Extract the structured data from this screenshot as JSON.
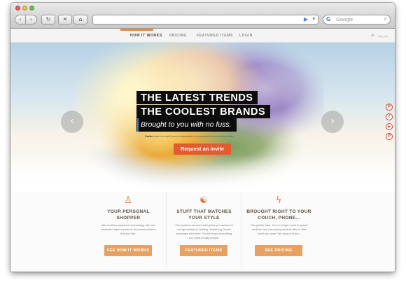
{
  "browser": {
    "back_icon": "‹",
    "forward_icon": "›",
    "reload_icon": "↻",
    "stop_icon": "✕",
    "home_icon": "⌂",
    "go_icon": "▶",
    "url_dropdown_icon": "▾",
    "search_engine_logo": "G",
    "search_placeholder": "Google",
    "search_icon": "⌕"
  },
  "nav": {
    "items": [
      {
        "label": "HOW IT WORKS"
      },
      {
        "label": "PRICING"
      },
      {
        "label": "FEATURED ITEMS"
      },
      {
        "label": "LOGIN"
      }
    ],
    "signin_icon": "⊕",
    "signin_label": "Sign Up",
    "accent": "#e08c4f"
  },
  "hero": {
    "headline_1": "THE LATEST TRENDS",
    "headline_2": "THE COOLEST BRANDS",
    "subheadline": "Brought to you with no fuss.",
    "tagline_brand": "Sutter",
    "tagline_text": "finds the stuff you're interested in so you don't have to keep look...",
    "cta_label": "Request an invite",
    "cta_color": "#e35b31",
    "prev_icon": "‹",
    "next_icon": "›"
  },
  "social": [
    {
      "name": "pinterest",
      "glyph": "P"
    },
    {
      "name": "facebook",
      "glyph": "f"
    },
    {
      "name": "youtube",
      "glyph": "▶"
    },
    {
      "name": "pinterest-2",
      "glyph": "P"
    }
  ],
  "features": [
    {
      "icon": "♙",
      "title": "YOUR PERSONAL SHOPPER",
      "body": "We combine awesome technology with our dedicated style experts to recommend items that you like.",
      "button": "SEE HOW IT WORKS"
    },
    {
      "icon": "☯",
      "title": "STUFF THAT MATCHES YOUR STYLE",
      "body": "The partners we work with gives you access to a huge variety of clothing, furnishing, travel, packages and more. So we've got everything you need to stay unique.",
      "button": "FEATURED ITEMS"
    },
    {
      "icon": "ϟ",
      "title": "BROUGHT RIGHT TO YOUR COUCH, PHONE...",
      "body": "You got the idea. You no longer need to spend endless hours browsing several sites to find what you need. We bring it to you.",
      "button": "SEE PRICING"
    }
  ],
  "colors": {
    "feature_button": "#e6a265",
    "feature_icon": "#e3733c"
  }
}
